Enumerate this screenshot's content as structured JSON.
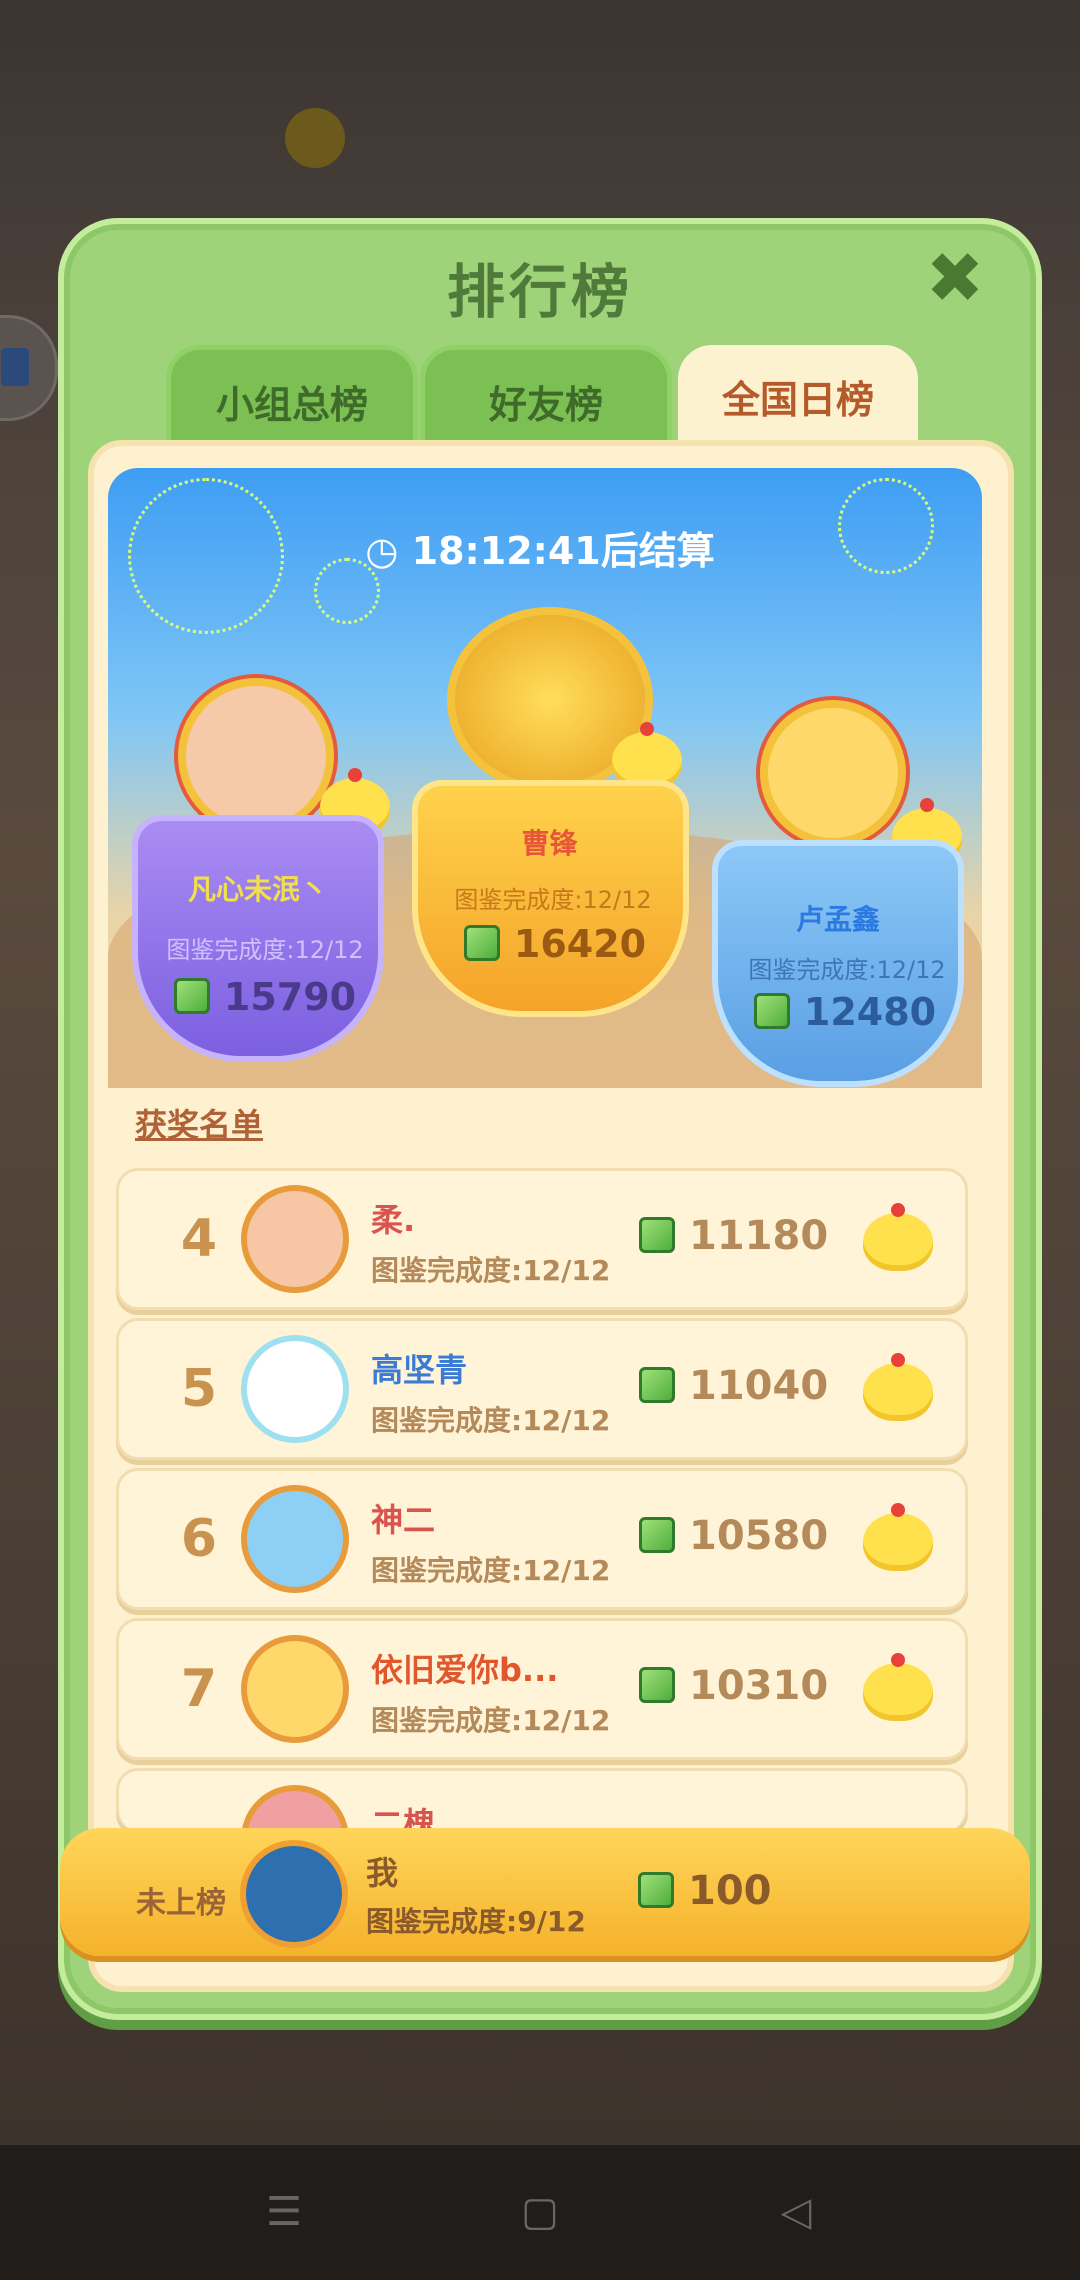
{
  "dialog": {
    "title": "排行榜",
    "close_icon": "close-x-icon"
  },
  "tabs": [
    {
      "label": "小组总榜",
      "active": false
    },
    {
      "label": "好友榜",
      "active": false
    },
    {
      "label": "全国日榜",
      "active": true
    }
  ],
  "timer": {
    "time": "18:12:41",
    "suffix": "后结算",
    "icon": "clock-icon"
  },
  "podium": [
    {
      "place": 2,
      "name": "凡心未泯丶",
      "progress": "图鉴完成度:12/12",
      "score": "15790"
    },
    {
      "place": 1,
      "name": "曹锋",
      "progress": "图鉴完成度:12/12",
      "score": "16420"
    },
    {
      "place": 3,
      "name": "卢孟鑫",
      "progress": "图鉴完成度:12/12",
      "score": "12480"
    }
  ],
  "section_title": "获奖名单",
  "ranking": [
    {
      "rank": "4",
      "name": "柔.",
      "progress": "图鉴完成度:12/12",
      "score": "11180",
      "name_color": "#d9534f"
    },
    {
      "rank": "5",
      "name": "高坚青",
      "progress": "图鉴完成度:12/12",
      "score": "11040",
      "name_color": "#3a7bd5"
    },
    {
      "rank": "6",
      "name": "神二",
      "progress": "图鉴完成度:12/12",
      "score": "10580",
      "name_color": "#d9534f"
    },
    {
      "rank": "7",
      "name": "依旧爱你b...",
      "progress": "图鉴完成度:12/12",
      "score": "10310",
      "name_color": "#e0572e"
    }
  ],
  "partial_row_name": "二槐",
  "me": {
    "rank_label": "未上榜",
    "name": "我",
    "progress": "图鉴完成度:9/12",
    "score": "100"
  },
  "colors": {
    "panel_green": "#9fd37a",
    "active_tab": "#fdf2cf",
    "score_brown": "#b48a5a"
  }
}
